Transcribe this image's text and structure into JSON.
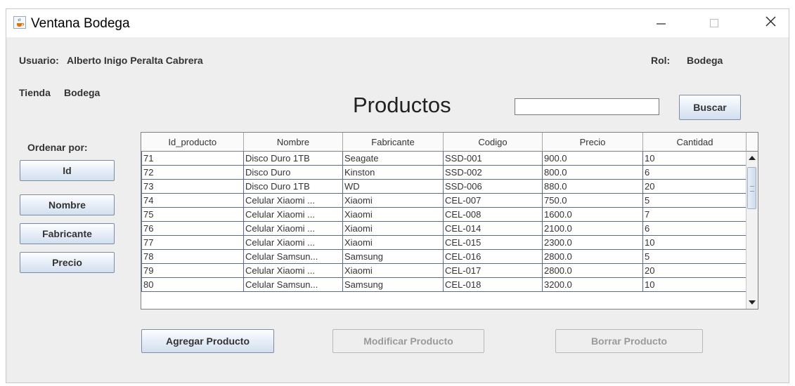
{
  "window": {
    "title": "Ventana Bodega",
    "icon": "java-coffee-icon"
  },
  "header": {
    "usuario_label": "Usuario:",
    "usuario_value": "Alberto Inigo Peralta Cabrera",
    "rol_label": "Rol:",
    "rol_value": "Bodega",
    "tienda_label": "Tienda",
    "tienda_value": "Bodega",
    "page_title": "Productos"
  },
  "search": {
    "value": "",
    "button_label": "Buscar"
  },
  "sort": {
    "label": "Ordenar por:",
    "buttons": [
      "Id",
      "Nombre",
      "Fabricante",
      "Precio"
    ]
  },
  "table": {
    "columns": [
      "Id_producto",
      "Nombre",
      "Fabricante",
      "Codigo",
      "Precio",
      "Cantidad"
    ],
    "rows": [
      [
        "71",
        "Disco Duro 1TB",
        "Seagate",
        "SSD-001",
        "900.0",
        "10"
      ],
      [
        "72",
        "Disco Duro",
        "Kinston",
        "SSD-002",
        "800.0",
        "6"
      ],
      [
        "73",
        "Disco Duro 1TB",
        "WD",
        "SSD-006",
        "880.0",
        "20"
      ],
      [
        "74",
        "Celular Xiaomi ...",
        "Xiaomi",
        "CEL-007",
        "750.0",
        "5"
      ],
      [
        "75",
        "Celular Xiaomi ...",
        "Xiaomi",
        "CEL-008",
        "1600.0",
        "7"
      ],
      [
        "76",
        "Celular Xiaomi ...",
        "Xiaomi",
        "CEL-014",
        "2100.0",
        "6"
      ],
      [
        "77",
        "Celular Xiaomi ...",
        "Xiaomi",
        "CEL-015",
        "2300.0",
        "10"
      ],
      [
        "78",
        "Celular Samsun...",
        "Samsung",
        "CEL-016",
        "2800.0",
        "5"
      ],
      [
        "79",
        "Celular Xiaomi ...",
        "Xiaomi",
        "CEL-017",
        "2800.0",
        "20"
      ],
      [
        "80",
        "Celular Samsun...",
        "Samsung",
        "CEL-018",
        "3200.0",
        "10"
      ]
    ]
  },
  "actions": {
    "add_label": "Agregar Producto",
    "modify_label": "Modificar Producto",
    "delete_label": "Borrar Producto"
  },
  "colors": {
    "grid_line": "#5b6b8c",
    "button_gradient_end": "#d2dfee",
    "window_bg": "#eeeeee"
  }
}
